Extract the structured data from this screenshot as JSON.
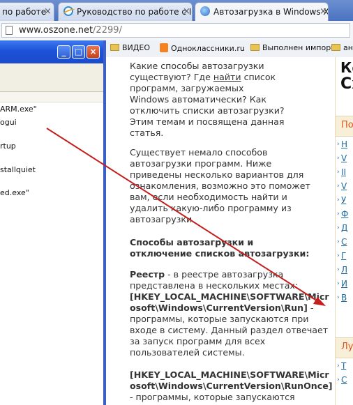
{
  "tabs": [
    {
      "label": "по работе",
      "state": "inactive"
    },
    {
      "label": "Руководство по работе с II",
      "state": "inactive"
    },
    {
      "label": "Автозагрузка в Windows XF",
      "state": "active"
    }
  ],
  "tab_close_glyph": "×",
  "address": {
    "host": "www.oszone.net",
    "path": "/2299/"
  },
  "bookmarks": [
    {
      "label": "ВИДЕО",
      "icon": "folder-icon"
    },
    {
      "label": "Одноклассники.ru",
      "icon": "odnoklassniki-icon"
    },
    {
      "label": "Выполнен импорт",
      "icon": "folder-icon"
    },
    {
      "label": "ан",
      "icon": "folder-icon"
    }
  ],
  "xp_window": {
    "buttons": {
      "minimize": "_",
      "maximize": "□",
      "close": "×"
    },
    "lines": [
      "ARM.exe\"",
      "ogui",
      "rtup",
      "stallquiet",
      "ed.exe\""
    ]
  },
  "article": {
    "p1": {
      "before_link": "Какие способы автозагрузки существуют? Где ",
      "link": "найти",
      "after_link": " список программ, загружаемых Windows автоматически? Как отключить списки автозагрузки? Этим темам и посвящена данная статья."
    },
    "p2": "Существует немало способов автозагрузки программ. Ниже приведены несколько вариантов для ознакомления, возможно это поможет вам, если необходимость найти и удалить какую-либо программу из автозагрузки.",
    "heading": "Способы автозагрузки и отключение списков автозагрузки:",
    "registry_label": "Реестр",
    "registry_text": " - в реестре автозагрузка представлена в нескольких местах:",
    "key1": "[HKEY_LOCAL_MACHINE\\SOFTWARE\\Microsoft\\Windows\\CurrentVersion\\Run]",
    "key1_desc": " - программы, которые запускаются при входе в систему. Данный раздел отвечает за запуск программ для всех пользователей системы.",
    "key2": "[HKEY_LOCAL_MACHINE\\SOFTWARE\\Microsoft\\Windows\\CurrentVersion\\RunOnce]",
    "key2_desc": " - программы, которые запускаются"
  },
  "right_column": {
    "ad_lines": [
      "Ко",
      "Сх"
    ],
    "section1": "По",
    "section1_items": [
      "Н",
      "V",
      "II",
      "V",
      "У",
      "Ф",
      "Д",
      "С",
      "Г",
      "Л",
      "И",
      "В"
    ],
    "section2": "Лу",
    "section2_items": [
      "T",
      "С"
    ]
  },
  "colors": {
    "arrow": "#c41e1e",
    "xp_title": "#1c52d8",
    "accent": "#e0521c"
  }
}
